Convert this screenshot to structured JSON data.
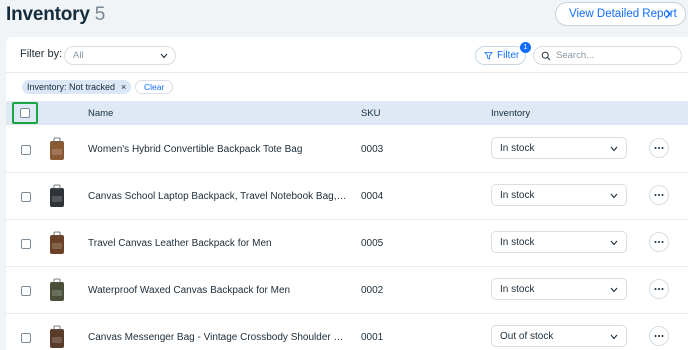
{
  "header": {
    "title": "Inventory",
    "count": "5",
    "report_button": "View Detailed Report"
  },
  "filterbar": {
    "filter_by_label": "Filter by:",
    "filter_select_value": "All",
    "filter_button": "Filter",
    "filter_badge": "1",
    "search_placeholder": "Search..."
  },
  "chips": {
    "active_filter": "Inventory: Not tracked",
    "remove_glyph": "×",
    "clear_button": "Clear"
  },
  "table": {
    "columns": [
      "Name",
      "SKU",
      "Inventory"
    ],
    "rows": [
      {
        "name": "Women's Hybrid Convertible Backpack Tote Bag",
        "sku": "0003",
        "inventory": "In stock",
        "thumb_color": "#8a5a34"
      },
      {
        "name": "Canvas School Laptop Backpack, Travel Notebook Bag, fo…",
        "sku": "0004",
        "inventory": "In stock",
        "thumb_color": "#2e3338"
      },
      {
        "name": "Travel Canvas Leather Backpack for Men",
        "sku": "0005",
        "inventory": "In stock",
        "thumb_color": "#6b4228"
      },
      {
        "name": "Waterproof Waxed Canvas Backpack for Men",
        "sku": "0002",
        "inventory": "In stock",
        "thumb_color": "#4a4f3a"
      },
      {
        "name": "Canvas Messenger Bag - Vintage Crossbody Shoulder Bag",
        "sku": "0001",
        "inventory": "Out of stock",
        "thumb_color": "#5a3a28"
      }
    ]
  },
  "colors": {
    "accent": "#116dff",
    "header_row": "#dfe9f6",
    "highlight_box": "#19a544",
    "page_bg": "#f0f4f7"
  },
  "icons": {
    "report_chevron": "chevron-right-icon",
    "filter": "funnel-icon",
    "search": "search-icon",
    "dropdown": "chevron-down-icon",
    "row_actions": "more-horizontal-icon"
  }
}
